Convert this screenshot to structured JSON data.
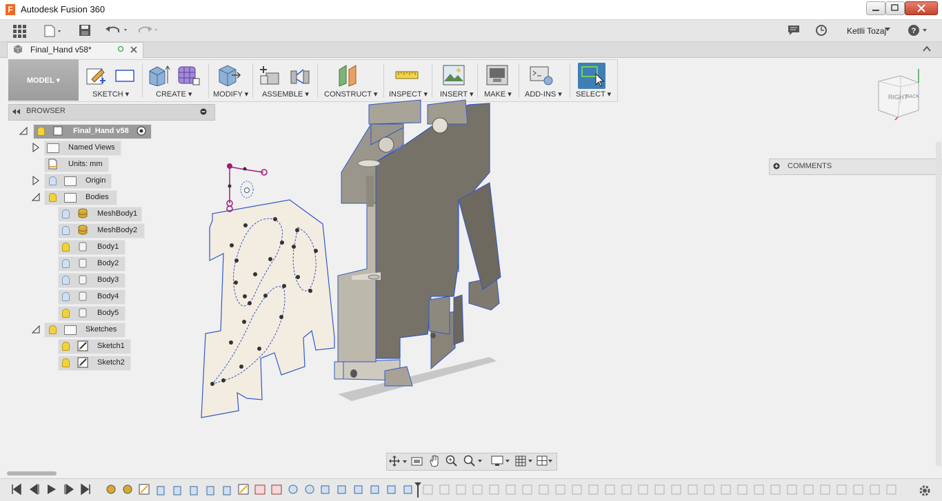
{
  "window": {
    "title": "Autodesk Fusion 360",
    "logo_letter": "F"
  },
  "user": {
    "name": "Ketlli Tozaj"
  },
  "document": {
    "tab_label": "Final_Hand v58*"
  },
  "ribbon": {
    "workspace": "MODEL ▾",
    "groups": [
      "SKETCH ▾",
      "CREATE ▾",
      "MODIFY ▾",
      "ASSEMBLE ▾",
      "CONSTRUCT ▾",
      "INSPECT ▾",
      "INSERT ▾",
      "MAKE ▾",
      "ADD-INS ▾",
      "SELECT ▾"
    ]
  },
  "browser": {
    "title": "BROWSER",
    "root": "Final_Hand v58",
    "named_views": "Named Views",
    "units": "Units: mm",
    "origin": "Origin",
    "bodies": "Bodies",
    "body_items": [
      "MeshBody1",
      "MeshBody2",
      "Body1",
      "Body2",
      "Body3",
      "Body4",
      "Body5"
    ],
    "sketches": "Sketches",
    "sketch_items": [
      "Sketch1",
      "Sketch2"
    ]
  },
  "comments": {
    "label": "COMMENTS"
  },
  "viewcube": {
    "right": "RIGHT",
    "back": "BACK"
  },
  "colors": {
    "accent": "#f26722",
    "select": "#3f7fb6",
    "edge": "#2f59c9",
    "body": "#8f8a7e"
  }
}
